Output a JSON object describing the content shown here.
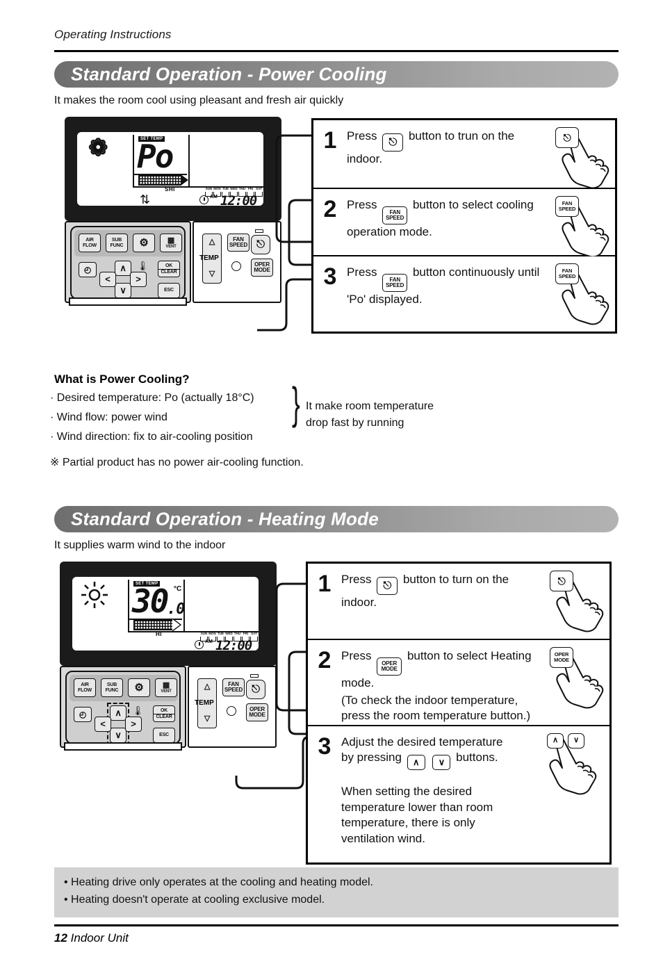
{
  "document": {
    "running_head": "Operating Instructions",
    "footer_page": "12",
    "footer_label": "Indoor Unit"
  },
  "sections": [
    {
      "title": "Standard Operation - Power Cooling",
      "subtitle": "It makes the room cool using pleasant and fresh air quickly",
      "remote": {
        "mode_icon": "snowflake-icon",
        "set_temp_tag": "SET TEMP",
        "display_value": "Po",
        "unit": "",
        "fan_label": "SHI",
        "swing_icon": "up-down-arrow-icon",
        "clock_ampm": "AM",
        "clock_time": "12:00",
        "days": [
          "SUN",
          "MON",
          "TUE",
          "WED",
          "THU",
          "FRI",
          "SAT"
        ],
        "buttons_top": [
          "AIR FLOW",
          "SUB FUNC",
          "gear-icon",
          "VENT"
        ],
        "buttons_misc": {
          "timer": "clock-icon",
          "up": "∧",
          "down": "∨",
          "left": "<",
          "right": ">",
          "room_temp": "thermometer-icon",
          "ok_clear_line1": "OK",
          "ok_clear_line2": "CLEAR",
          "esc": "ESC"
        },
        "buttons_right": {
          "temp_label": "TEMP",
          "temp_up": "△",
          "temp_down": "▽",
          "fan_speed_line1": "FAN",
          "fan_speed_line2": "SPEED",
          "power": "power-icon",
          "oper_mode_line1": "OPER",
          "oper_mode_line2": "MODE"
        }
      },
      "steps": [
        {
          "number": "1",
          "text_before": "Press",
          "button_label_1": "",
          "button_label_2": "",
          "button_kind": "power",
          "text_after": "button to trun on the indoor.",
          "hand_button_1": "",
          "hand_button_2": "",
          "hand_button_kind": "power"
        },
        {
          "number": "2",
          "text_before": "Press",
          "button_label_1": "FAN",
          "button_label_2": "SPEED",
          "button_kind": "text",
          "text_after": "button to select cooling operation mode.",
          "hand_button_1": "FAN",
          "hand_button_2": "SPEED",
          "hand_button_kind": "text"
        },
        {
          "number": "3",
          "text_before": "Press",
          "button_label_1": "FAN",
          "button_label_2": "SPEED",
          "button_kind": "text",
          "text_after": "button continuously until 'Po' displayed.",
          "hand_button_1": "FAN",
          "hand_button_2": "SPEED",
          "hand_button_kind": "text"
        }
      ]
    },
    {
      "title": "Standard Operation - Heating Mode",
      "subtitle": "It supplies warm wind to the indoor",
      "remote": {
        "mode_icon": "sun-icon",
        "set_temp_tag": "SET TEMP",
        "display_value": "30",
        "display_decimal": ".0",
        "unit": "°C",
        "fan_label": "HI",
        "clock_ampm": "AM",
        "clock_time": "12:00",
        "days": [
          "SUN",
          "MON",
          "TUE",
          "WED",
          "THU",
          "FRI",
          "SAT"
        ]
      },
      "steps": [
        {
          "number": "1",
          "text_before": "Press",
          "button_kind": "power",
          "text_after": "button to turn on the indoor.",
          "hand_button_kind": "power"
        },
        {
          "number": "2",
          "text_before": "Press",
          "button_label_1": "OPER",
          "button_label_2": "MODE",
          "button_kind": "text",
          "text_after": "button to select Heating mode.",
          "text_extra": "(To check the indoor temperature, press the room temperature button.)",
          "hand_button_1": "OPER",
          "hand_button_2": "MODE",
          "hand_button_kind": "text"
        },
        {
          "number": "3",
          "text_line1": "Adjust the desired temperature",
          "text_line2_before": "by pressing",
          "arrow_up": "∧",
          "arrow_down": "∨",
          "text_line2_after": "buttons.",
          "text_extra": "When setting the desired temperature lower than room temperature, there is only ventilation wind."
        }
      ]
    }
  ],
  "what_is": {
    "title": "What is Power Cooling?",
    "items": [
      "· Desired temperature: Po (actually 18°C)",
      "· Wind flow: power wind",
      "· Wind direction: fix to air-cooling position"
    ],
    "brace_text_line1": "It make room temperature",
    "brace_text_line2": "drop fast by running",
    "footnote": "※ Partial product has no power air-cooling function."
  },
  "gray_note": {
    "line1": "• Heating drive only operates at the cooling and heating model.",
    "line2": "• Heating doesn't operate at cooling exclusive model."
  },
  "colors": {
    "bar_gradient_start": "#6e6e6e",
    "bar_gradient_end": "#b2b2b2",
    "note_bg": "#d2d2d2",
    "panel_gray": "#cfcfcf"
  }
}
